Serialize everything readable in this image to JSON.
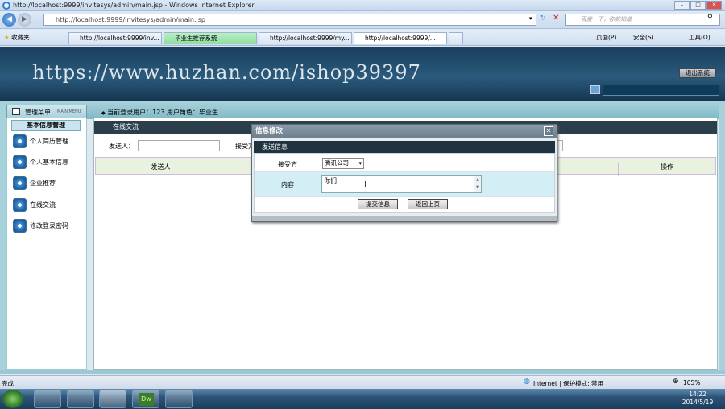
{
  "window": {
    "title": "http://localhost:9999/invitesys/admin/main.jsp - Windows Internet Explorer",
    "minimize": "–",
    "maximize": "□",
    "close": "✕"
  },
  "addressbar": {
    "url": "http://localhost:9999/invitesys/admin/main.jsp",
    "search_placeholder": "百度一下，你就知道"
  },
  "tabs": [
    {
      "label": "收藏夹"
    },
    {
      "label": "http://localhost:9999/inv..."
    },
    {
      "label": "毕业生推荐系统"
    },
    {
      "label": "http://localhost:9999/my..."
    },
    {
      "label": "http://localhost:9999/..."
    }
  ],
  "toolbar": {
    "page": "页面(P)",
    "safety": "安全(S)",
    "tools": "工具(O)"
  },
  "banner": {
    "watermark": "https://www.huzhan.com/ishop39397",
    "logout": "退出系统"
  },
  "userbar": {
    "menu_title": "管理菜单",
    "menu_sub": "MAIN MENU",
    "user_info": "当前登录用户：123  用户角色：毕业生"
  },
  "sidebar": {
    "section": "基本信息管理",
    "items": [
      {
        "label": "个人简历管理"
      },
      {
        "label": "个人基本信息"
      },
      {
        "label": "企业推荐"
      },
      {
        "label": "在线交流"
      },
      {
        "label": "修改登录密码"
      }
    ]
  },
  "main": {
    "title": "在线交流",
    "filter_sender_label": "发送人：",
    "filter_receiver_label": "接受方",
    "columns": [
      "发送人",
      "操作"
    ]
  },
  "dialog": {
    "title": "信息修改",
    "close": "✕",
    "subtitle": "发送信息",
    "receiver_label": "接受方",
    "receiver_value": "腾讯公司",
    "content_label": "内容",
    "content_value": "你们",
    "submit": "提交信息",
    "back": "返回上页"
  },
  "statusbar": {
    "left": "完成",
    "zone": "Internet | 保护模式: 禁用",
    "zoom": "105%"
  },
  "taskbar": {
    "time": "14:22",
    "date": "2014/5/19"
  }
}
